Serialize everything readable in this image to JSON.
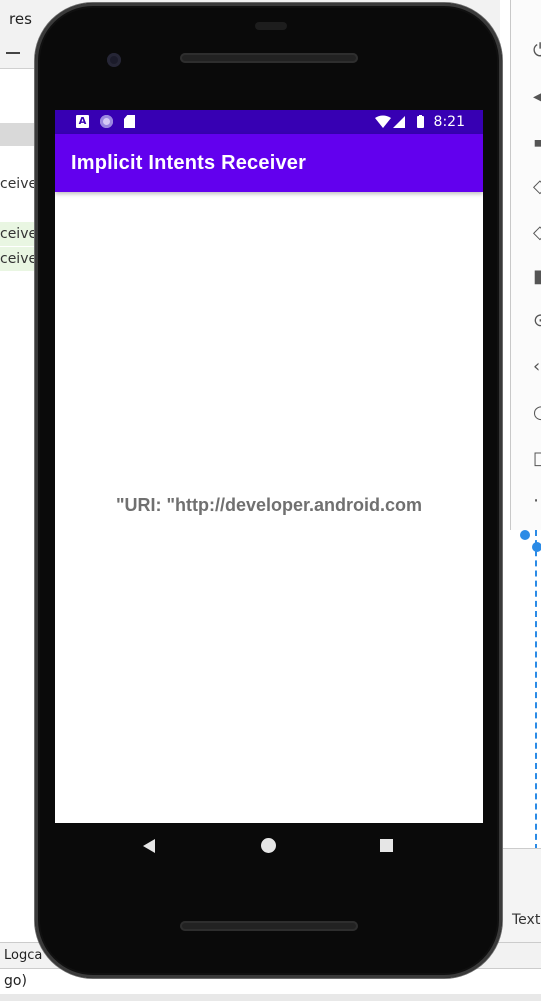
{
  "ide": {
    "tab_label": "res",
    "editor_lines": [
      "ceive",
      "ceive",
      "ceive"
    ],
    "bottom_tab": "Logca",
    "bottom_status": "go)",
    "right_tab": "Text"
  },
  "phone": {
    "status_bar": {
      "time": "8:21",
      "notification_icon_letter": "A",
      "color": "#3700b3"
    },
    "app_bar": {
      "title": "Implicit Intents Receiver",
      "color": "#6200ee"
    },
    "content": {
      "uri_text": "\"URI: \"http://developer.android.com"
    },
    "nav": {
      "back": "back-icon",
      "home": "home-icon",
      "recents": "recents-icon"
    }
  }
}
